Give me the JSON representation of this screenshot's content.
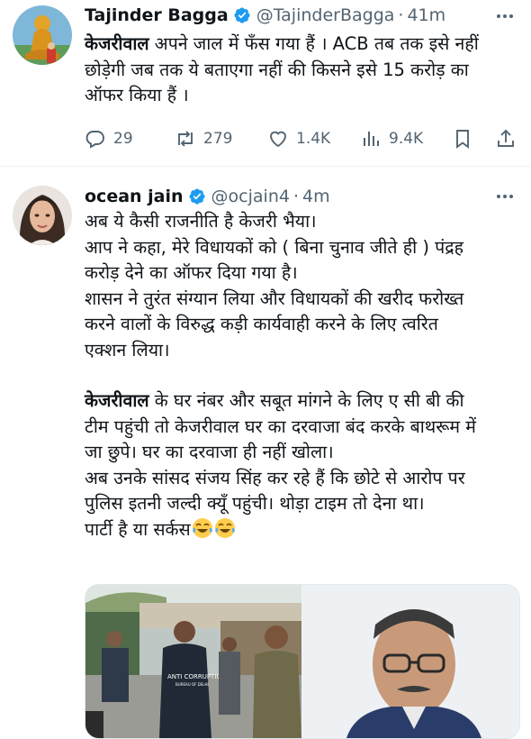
{
  "tweets": [
    {
      "author_name": "Tajinder Bagga",
      "handle": "@TajinderBagga",
      "separator": "·",
      "time": "41m",
      "highlight": "केजरीवाल",
      "text_lines": [
        " अपने जाल में फँस गया हैं । ACB तब तक इसे नहीं",
        "छोड़ेगी जब तक ये बताएगा नहीं की किसने इसे 15 करोड़ का",
        "ऑफर किया हैं ।"
      ],
      "stats": {
        "replies": "29",
        "reposts": "279",
        "likes": "1.4K",
        "views": "9.4K"
      },
      "icons": [
        "reply-icon",
        "repost-icon",
        "like-icon",
        "views-icon",
        "bookmark-icon",
        "share-icon"
      ]
    },
    {
      "author_name": "ocean jain",
      "handle": "@ocjain4",
      "separator": "·",
      "time": "4m",
      "paragraph1": [
        "अब ये कैसी राजनीति है केजरी भैया।",
        "आप ने कहा, मेरे विधायकों को ( बिना चुनाव जीते ही ) पंद्रह",
        "करोड़ देने का ऑफर दिया गया है।",
        "शासन ने तुरंत संग्यान लिया और विधायकों की खरीद फरोख्त",
        "करने वालों के विरुद्ध कड़ी कार्यवाही करने के लिए त्वरित",
        "एक्शन लिया।"
      ],
      "highlight": "केजरीवाल",
      "paragraph2_first": " के घर नंबर और सबूत मांगने के लिए ए सी बी की",
      "paragraph2": [
        "टीम पहुंची तो केजरीवाल घर का दरवाजा बंद करके बाथरूम में",
        "जा छुपे। घर का दरवाजा ही नहीं खोला।",
        "अब उनके सांसद संजय सिंह कर रहे हैं कि छोटे से आरोप पर",
        "पुलिस इतनी जल्दी क्यूँ पहुंची। थोड़ा टाइम तो देना था।"
      ],
      "last_line": "पार्टी है या सर्कस",
      "emoji": "face-with-tears-of-joy-icon",
      "jacket_text": "ANTI CORRUPTION",
      "jacket_subtext": "BUREAU OF DELHI"
    }
  ],
  "colors": {
    "text": "#0f1419",
    "secondary": "#536471",
    "verified": "#1d9bf0",
    "divider": "#eff3f4"
  }
}
